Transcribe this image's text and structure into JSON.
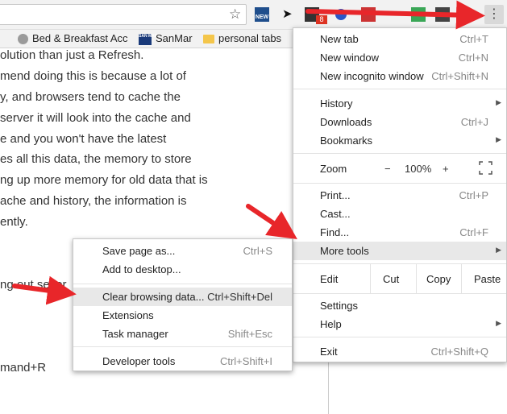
{
  "toolbar": {
    "star_icon": "star-icon",
    "menu_icon": "three-dots-icon",
    "extension_new_label": "NEW",
    "extension_badge": "8"
  },
  "bookmarks": [
    {
      "label": "Bed & Breakfast Acc",
      "icon": "gear-icon"
    },
    {
      "label": "SanMar",
      "icon": "sanmar-logo"
    },
    {
      "label": "personal tabs",
      "icon": "folder-icon"
    }
  ],
  "sanmar_logo_text": "SAN MAR",
  "page": {
    "lines": [
      "olution than just a Refresh.",
      "mend doing this is because a lot of",
      "y, and browsers tend to cache the",
      "server it will look into the cache and",
      "e and you won't have the latest",
      "es all this data, the memory to store",
      "ng up more memory for old data that is",
      "ache and history, the information is",
      "ently.",
      "",
      "",
      "ng out sever",
      "",
      "",
      "",
      "mand+R"
    ]
  },
  "menu": {
    "new_tab": {
      "label": "New tab",
      "shortcut": "Ctrl+T"
    },
    "new_window": {
      "label": "New window",
      "shortcut": "Ctrl+N"
    },
    "new_incognito": {
      "label": "New incognito window",
      "shortcut": "Ctrl+Shift+N"
    },
    "history": {
      "label": "History"
    },
    "downloads": {
      "label": "Downloads",
      "shortcut": "Ctrl+J"
    },
    "bookmarks": {
      "label": "Bookmarks"
    },
    "zoom": {
      "label": "Zoom",
      "minus": "−",
      "level": "100%",
      "plus": "+",
      "fullscreen_icon": "fullscreen-icon"
    },
    "print": {
      "label": "Print...",
      "shortcut": "Ctrl+P"
    },
    "cast": {
      "label": "Cast..."
    },
    "find": {
      "label": "Find...",
      "shortcut": "Ctrl+F"
    },
    "more_tools": {
      "label": "More tools"
    },
    "edit": {
      "label": "Edit",
      "cut": "Cut",
      "copy": "Copy",
      "paste": "Paste"
    },
    "settings": {
      "label": "Settings"
    },
    "help": {
      "label": "Help"
    },
    "exit": {
      "label": "Exit",
      "shortcut": "Ctrl+Shift+Q"
    }
  },
  "submenu": {
    "save_page": {
      "label": "Save page as...",
      "shortcut": "Ctrl+S"
    },
    "add_desktop": {
      "label": "Add to desktop..."
    },
    "clear_browsing": {
      "label": "Clear browsing data...",
      "shortcut": "Ctrl+Shift+Del"
    },
    "extensions": {
      "label": "Extensions"
    },
    "task_manager": {
      "label": "Task manager",
      "shortcut": "Shift+Esc"
    },
    "developer_tools": {
      "label": "Developer tools",
      "shortcut": "Ctrl+Shift+I"
    }
  },
  "annotation_color": "#e8262a"
}
